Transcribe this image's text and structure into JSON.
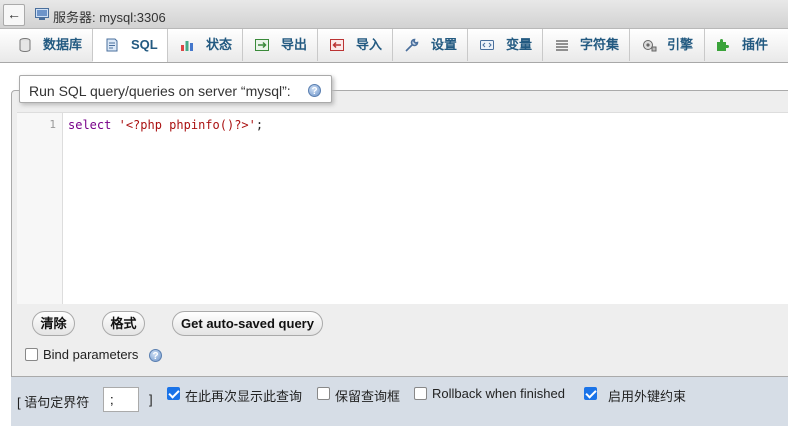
{
  "window": {
    "back_glyph": "←",
    "title": "服务器: mysql:3306"
  },
  "tabs": [
    {
      "label": "数据库",
      "icon": "database-icon"
    },
    {
      "label": "SQL",
      "icon": "sql-icon",
      "active": true
    },
    {
      "label": "状态",
      "icon": "status-icon"
    },
    {
      "label": "导出",
      "icon": "export-icon"
    },
    {
      "label": "导入",
      "icon": "import-icon"
    },
    {
      "label": "设置",
      "icon": "wrench-icon"
    },
    {
      "label": "变量",
      "icon": "variables-icon"
    },
    {
      "label": "字符集",
      "icon": "charset-icon"
    },
    {
      "label": "引擎",
      "icon": "engine-icon"
    },
    {
      "label": "插件",
      "icon": "plugin-icon"
    }
  ],
  "query_panel": {
    "legend": "Run SQL query/queries on server “mysql”:",
    "help_glyph": "?",
    "editor": {
      "line_number": "1",
      "code_keyword": "select",
      "code_string": "'<?php phpinfo()?>'",
      "code_end": ";"
    }
  },
  "buttons": {
    "clear": "清除",
    "format": "格式",
    "autosaved": "Get auto-saved query"
  },
  "bind_parameters": {
    "label": "Bind parameters",
    "checked": false
  },
  "options": {
    "delimiter_label_open": "[ 语句定界符",
    "delimiter_value": ";",
    "delimiter_label_close": "]",
    "show_again": {
      "label": "在此再次显示此查询",
      "checked": true
    },
    "retain_box": {
      "label": "保留查询框",
      "checked": false
    },
    "rollback": {
      "label": "Rollback when finished",
      "checked": false
    },
    "foreign_keys": {
      "label": "启用外键约束",
      "checked": true
    }
  },
  "colors": {
    "tab_text": "#235a81",
    "checkbox_on": "#1a73e8",
    "options_bar": "#d6dde6"
  }
}
